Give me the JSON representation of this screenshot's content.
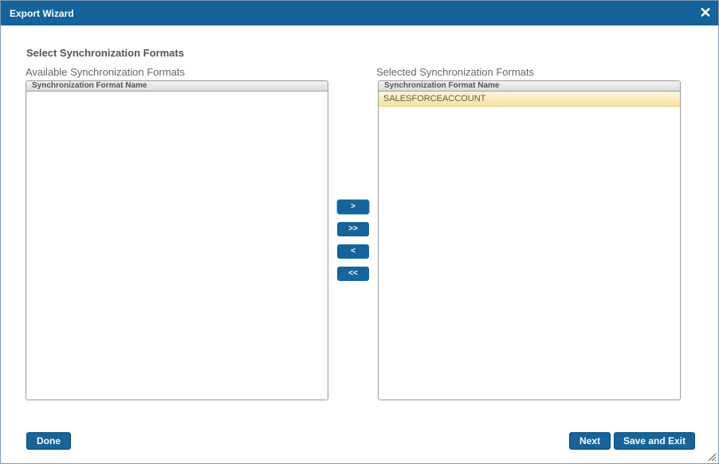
{
  "window": {
    "title": "Export Wizard",
    "close_glyph": "✕"
  },
  "section_title": "Select Synchronization Formats",
  "available": {
    "label": "Available Synchronization Formats",
    "column_header": "Synchronization Format Name",
    "items": []
  },
  "selected": {
    "label": "Selected Synchronization Formats",
    "column_header": "Synchronization Format Name",
    "items": [
      "SALESFORCEACCOUNT"
    ]
  },
  "move_buttons": {
    "add": ">",
    "add_all": ">>",
    "remove": "<",
    "remove_all": "<<"
  },
  "footer": {
    "done": "Done",
    "next": "Next",
    "save_exit": "Save and Exit"
  },
  "colors": {
    "accent": "#14639a",
    "selected_row": "#f6e2a0"
  },
  "icons": {
    "close": "close-icon",
    "resize": "resize-grip-icon"
  }
}
